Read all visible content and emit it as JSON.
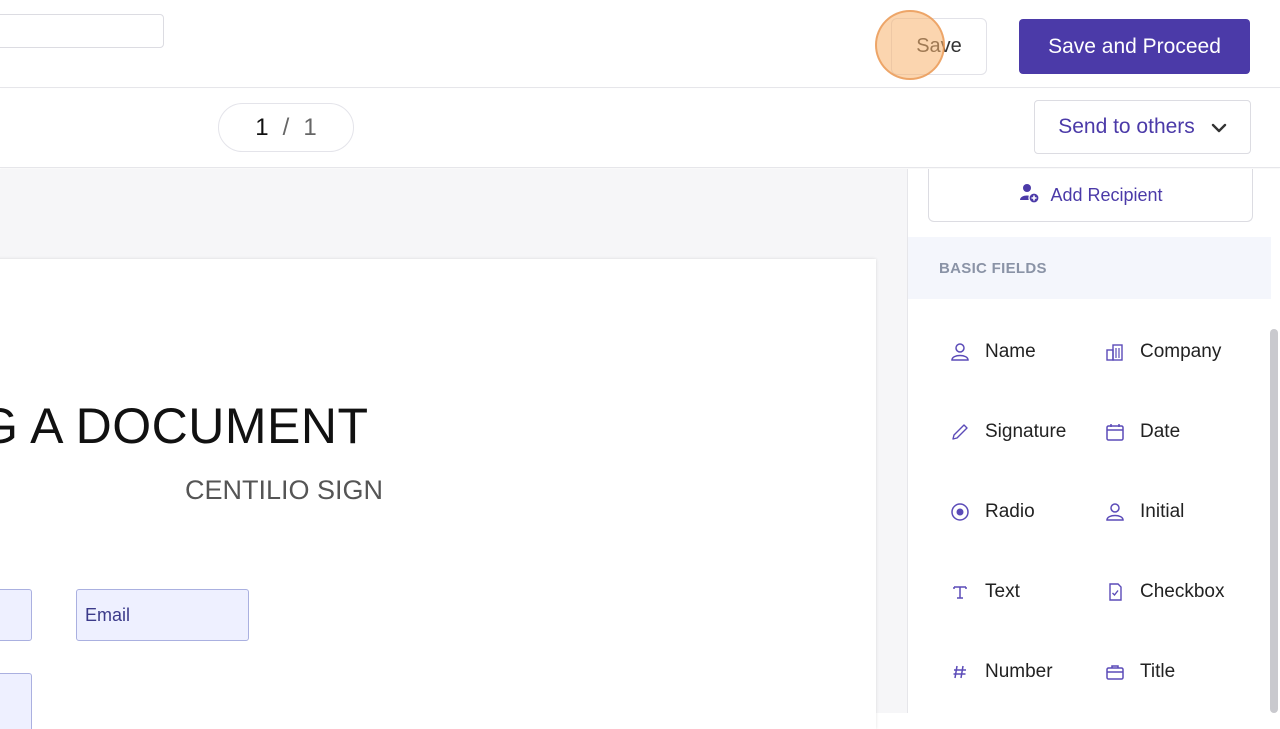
{
  "header": {
    "save_label": "Save",
    "save_proceed_label": "Save and Proceed"
  },
  "toolbar": {
    "page_current": "1",
    "page_sep": "/",
    "page_total": "1",
    "send_label": "Send to others"
  },
  "document": {
    "title": "UPLOADING A DOCUMENT",
    "subtitle": "CENTILIO SIGN",
    "email_field": "Email"
  },
  "sidebar": {
    "add_recipient": "Add Recipient",
    "section_title": "BASIC FIELDS",
    "fields": [
      {
        "label": "Name",
        "icon": "user-icon"
      },
      {
        "label": "Company",
        "icon": "building-icon"
      },
      {
        "label": "Signature",
        "icon": "pen-icon"
      },
      {
        "label": "Date",
        "icon": "calendar-icon"
      },
      {
        "label": "Radio",
        "icon": "radio-icon"
      },
      {
        "label": "Initial",
        "icon": "user-icon"
      },
      {
        "label": "Text",
        "icon": "text-icon"
      },
      {
        "label": "Checkbox",
        "icon": "checkbox-icon"
      },
      {
        "label": "Number",
        "icon": "hash-icon"
      },
      {
        "label": "Title",
        "icon": "briefcase-icon"
      }
    ]
  },
  "colors": {
    "accent": "#4b3aa8",
    "section_bg": "#f4f6fc"
  }
}
